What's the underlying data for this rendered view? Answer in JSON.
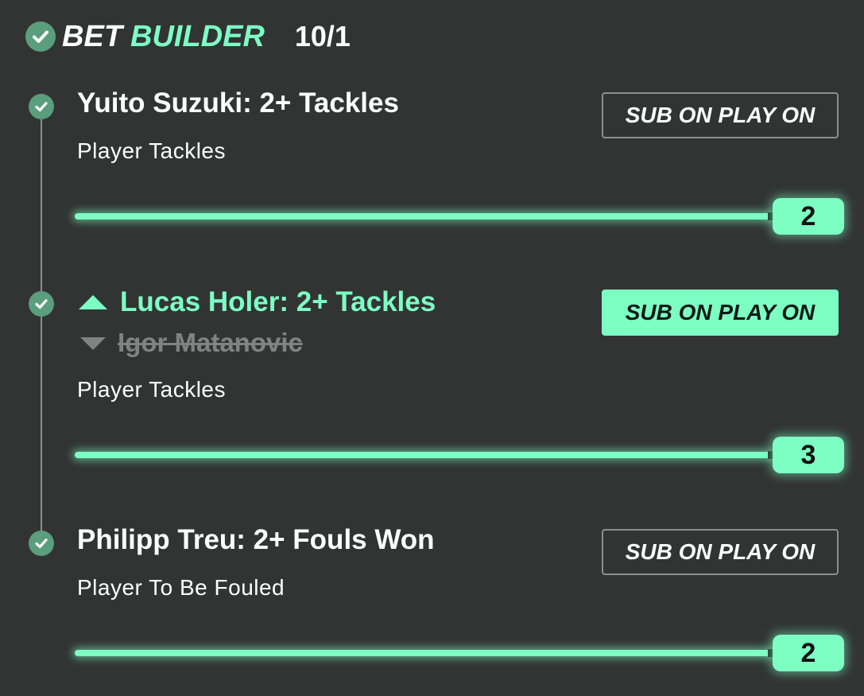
{
  "header": {
    "title_bet": "BET",
    "title_builder": "BUILDER",
    "odds": "10/1"
  },
  "legs": [
    {
      "title": "Yuito Suzuki: 2+ Tackles",
      "market": "Player Tackles",
      "sub_button": "SUB ON PLAY ON",
      "sub_active": false,
      "value": "2"
    },
    {
      "title": "Lucas Holer: 2+ Tackles",
      "replaced_player": "Igor Matanovic",
      "market": "Player Tackles",
      "sub_button": "SUB ON PLAY ON",
      "sub_active": true,
      "value": "3"
    },
    {
      "title": "Philipp Treu: 2+ Fouls Won",
      "market": "Player To Be Fouled",
      "sub_button": "SUB ON PLAY ON",
      "sub_active": false,
      "value": "2"
    }
  ],
  "colors": {
    "background": "#323434",
    "accent": "#7dffc4",
    "check": "#5a9e7c",
    "muted": "#7f8382"
  },
  "icons": {
    "check": "check-circle-icon",
    "up": "arrow-up-icon",
    "down": "arrow-down-icon"
  }
}
